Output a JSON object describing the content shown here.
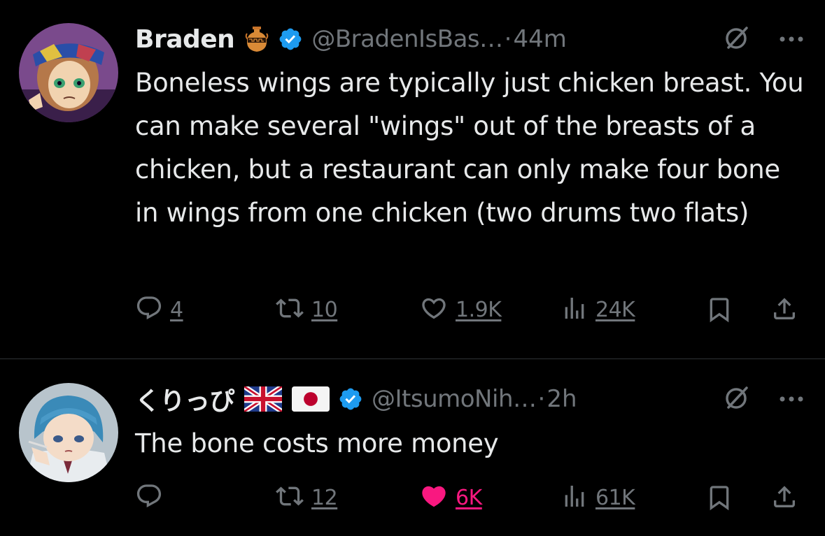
{
  "tweets": [
    {
      "name": "Braden",
      "emoji_icons": [
        "amphora-icon"
      ],
      "handle": "@BradenIsBas…",
      "sep": "·",
      "time": "44m",
      "text": "Boneless wings are typically just chicken breast. You can make several \"wings\" out of the breasts of a chicken, but a restaurant can only make four bone in wings from one chicken (two drums two flats)",
      "replies": "4",
      "reposts": "10",
      "likes": "1.9K",
      "views": "24K",
      "liked": false
    },
    {
      "name": "くりっぴ",
      "emoji_icons": [
        "uk-flag-icon",
        "japan-flag-icon"
      ],
      "handle": "@ItsumoNih…",
      "sep": "·",
      "time": "2h",
      "text": "The bone costs more money",
      "replies": "",
      "reposts": "12",
      "likes": "6K",
      "views": "61K",
      "liked": true
    }
  ],
  "colors": {
    "background": "#000000",
    "text": "#e7e9ea",
    "muted": "#71767b",
    "verified": "#1d9bf0",
    "like": "#f91880"
  }
}
